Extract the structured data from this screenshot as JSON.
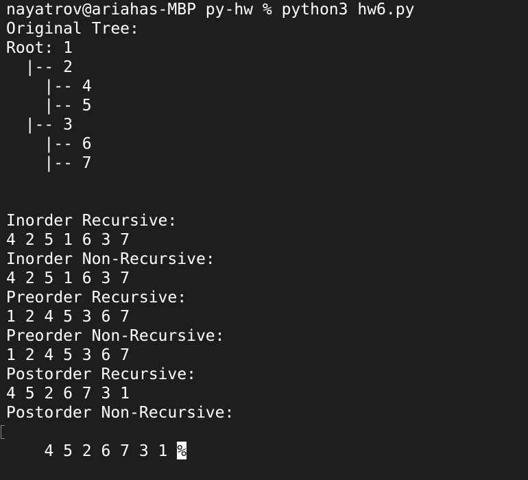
{
  "terminal": {
    "command_line": "nayatrov@ariahas-MBP py-hw % python3 hw6.py",
    "tree_title": "Original Tree:",
    "tree_root": "Root: 1",
    "tree_lines": [
      "  |-- 2",
      "    |-- 4",
      "    |-- 5",
      "  |-- 3",
      "    |-- 6",
      "    |-- 7"
    ],
    "traversals": [
      {
        "label": "Inorder Recursive:",
        "result": "4 2 5 1 6 3 7"
      },
      {
        "label": "Inorder Non-Recursive:",
        "result": "4 2 5 1 6 3 7"
      },
      {
        "label": "Preorder Recursive:",
        "result": "1 2 4 5 3 6 7"
      },
      {
        "label": "Preorder Non-Recursive:",
        "result": "1 2 4 5 3 6 7"
      },
      {
        "label": "Postorder Recursive:",
        "result": "4 5 2 6 7 3 1"
      },
      {
        "label": "Postorder Non-Recursive:",
        "result": "4 5 2 6 7 3 1 "
      }
    ],
    "end_marker": "%",
    "colors": {
      "background": "#1e1e1e",
      "text": "#ffffff"
    }
  }
}
